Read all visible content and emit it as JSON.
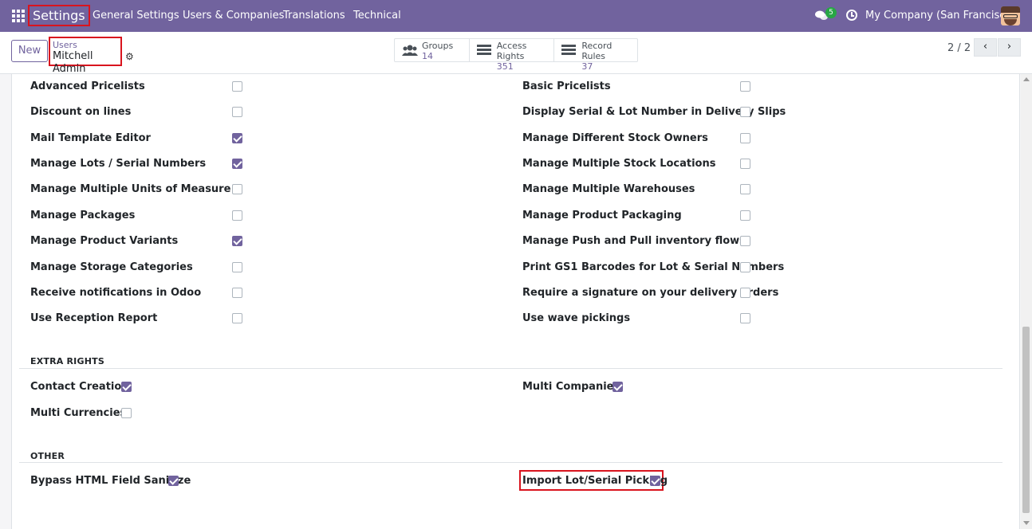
{
  "navbar": {
    "brand": "Settings",
    "menu": [
      "General Settings",
      "Users & Companies",
      "Translations",
      "Technical"
    ],
    "chat_badge": "5",
    "company": "My Company (San Francisco)"
  },
  "control": {
    "new_label": "New",
    "breadcrumb_parent": "Users",
    "breadcrumb_current": "Mitchell Admin",
    "smart_buttons": [
      {
        "label": "Groups",
        "value": "14",
        "icon": "users-icon"
      },
      {
        "label": "Access Rights",
        "value": "351",
        "icon": "list-icon"
      },
      {
        "label": "Record Rules",
        "value": "37",
        "icon": "list-icon"
      }
    ],
    "pager": "2 / 2"
  },
  "rights": {
    "left": [
      {
        "label": "Advanced Pricelists",
        "checked": false
      },
      {
        "label": "Discount on lines",
        "checked": false
      },
      {
        "label": "Mail Template Editor",
        "checked": true
      },
      {
        "label": "Manage Lots / Serial Numbers",
        "checked": true
      },
      {
        "label": "Manage Multiple Units of Measure",
        "checked": false
      },
      {
        "label": "Manage Packages",
        "checked": false
      },
      {
        "label": "Manage Product Variants",
        "checked": true
      },
      {
        "label": "Manage Storage Categories",
        "checked": false
      },
      {
        "label": "Receive notifications in Odoo",
        "checked": false
      },
      {
        "label": "Use Reception Report",
        "checked": false
      }
    ],
    "right": [
      {
        "label": "Basic Pricelists",
        "checked": false
      },
      {
        "label": "Display Serial & Lot Number in Delivery Slips",
        "checked": false
      },
      {
        "label": "Manage Different Stock Owners",
        "checked": false
      },
      {
        "label": "Manage Multiple Stock Locations",
        "checked": false
      },
      {
        "label": "Manage Multiple Warehouses",
        "checked": false
      },
      {
        "label": "Manage Product Packaging",
        "checked": false
      },
      {
        "label": "Manage Push and Pull inventory flows",
        "checked": false
      },
      {
        "label": "Print GS1 Barcodes for Lot & Serial Numbers",
        "checked": false
      },
      {
        "label": "Require a signature on your delivery orders",
        "checked": false
      },
      {
        "label": "Use wave pickings",
        "checked": false
      }
    ]
  },
  "extra_rights": {
    "title": "EXTRA RIGHTS",
    "items": [
      {
        "label": "Contact Creation",
        "checked": true
      },
      {
        "label": "Multi Companies",
        "checked": true
      },
      {
        "label": "Multi Currencies",
        "checked": false
      }
    ]
  },
  "other": {
    "title": "OTHER",
    "items": [
      {
        "label": "Bypass HTML Field Sanitize",
        "checked": true
      },
      {
        "label": "Import Lot/Serial Picking",
        "checked": true
      }
    ]
  },
  "colors": {
    "navbar": "#71639e",
    "highlight": "#d9141e"
  }
}
